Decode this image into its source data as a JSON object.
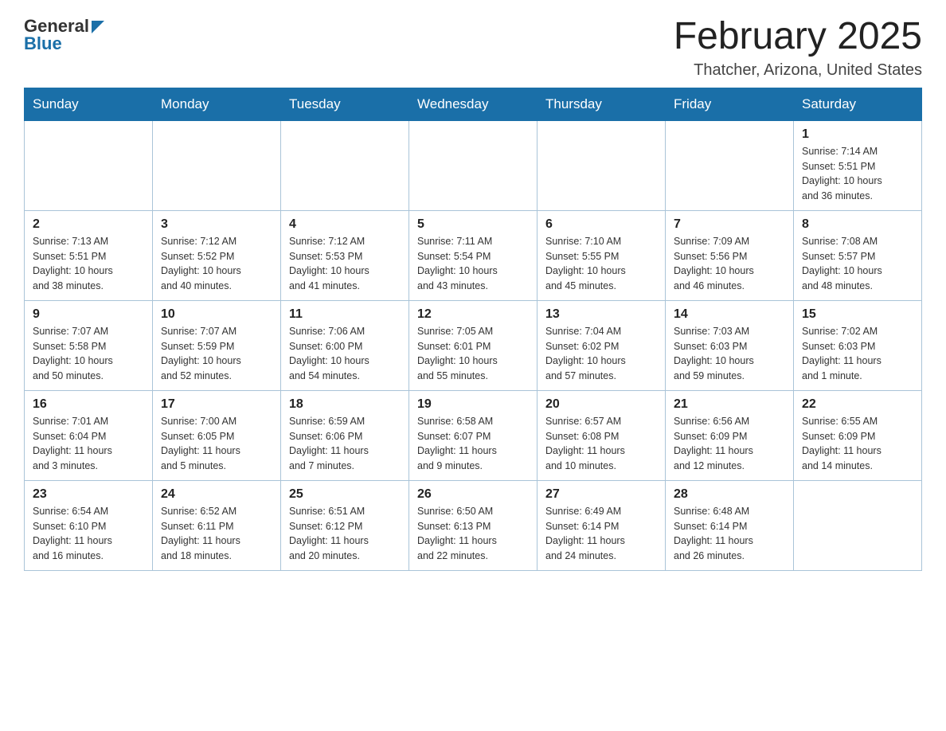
{
  "header": {
    "logo_general": "General",
    "logo_blue": "Blue",
    "month_title": "February 2025",
    "location": "Thatcher, Arizona, United States"
  },
  "weekdays": [
    "Sunday",
    "Monday",
    "Tuesday",
    "Wednesday",
    "Thursday",
    "Friday",
    "Saturday"
  ],
  "weeks": [
    [
      {
        "day": "",
        "info": ""
      },
      {
        "day": "",
        "info": ""
      },
      {
        "day": "",
        "info": ""
      },
      {
        "day": "",
        "info": ""
      },
      {
        "day": "",
        "info": ""
      },
      {
        "day": "",
        "info": ""
      },
      {
        "day": "1",
        "info": "Sunrise: 7:14 AM\nSunset: 5:51 PM\nDaylight: 10 hours\nand 36 minutes."
      }
    ],
    [
      {
        "day": "2",
        "info": "Sunrise: 7:13 AM\nSunset: 5:51 PM\nDaylight: 10 hours\nand 38 minutes."
      },
      {
        "day": "3",
        "info": "Sunrise: 7:12 AM\nSunset: 5:52 PM\nDaylight: 10 hours\nand 40 minutes."
      },
      {
        "day": "4",
        "info": "Sunrise: 7:12 AM\nSunset: 5:53 PM\nDaylight: 10 hours\nand 41 minutes."
      },
      {
        "day": "5",
        "info": "Sunrise: 7:11 AM\nSunset: 5:54 PM\nDaylight: 10 hours\nand 43 minutes."
      },
      {
        "day": "6",
        "info": "Sunrise: 7:10 AM\nSunset: 5:55 PM\nDaylight: 10 hours\nand 45 minutes."
      },
      {
        "day": "7",
        "info": "Sunrise: 7:09 AM\nSunset: 5:56 PM\nDaylight: 10 hours\nand 46 minutes."
      },
      {
        "day": "8",
        "info": "Sunrise: 7:08 AM\nSunset: 5:57 PM\nDaylight: 10 hours\nand 48 minutes."
      }
    ],
    [
      {
        "day": "9",
        "info": "Sunrise: 7:07 AM\nSunset: 5:58 PM\nDaylight: 10 hours\nand 50 minutes."
      },
      {
        "day": "10",
        "info": "Sunrise: 7:07 AM\nSunset: 5:59 PM\nDaylight: 10 hours\nand 52 minutes."
      },
      {
        "day": "11",
        "info": "Sunrise: 7:06 AM\nSunset: 6:00 PM\nDaylight: 10 hours\nand 54 minutes."
      },
      {
        "day": "12",
        "info": "Sunrise: 7:05 AM\nSunset: 6:01 PM\nDaylight: 10 hours\nand 55 minutes."
      },
      {
        "day": "13",
        "info": "Sunrise: 7:04 AM\nSunset: 6:02 PM\nDaylight: 10 hours\nand 57 minutes."
      },
      {
        "day": "14",
        "info": "Sunrise: 7:03 AM\nSunset: 6:03 PM\nDaylight: 10 hours\nand 59 minutes."
      },
      {
        "day": "15",
        "info": "Sunrise: 7:02 AM\nSunset: 6:03 PM\nDaylight: 11 hours\nand 1 minute."
      }
    ],
    [
      {
        "day": "16",
        "info": "Sunrise: 7:01 AM\nSunset: 6:04 PM\nDaylight: 11 hours\nand 3 minutes."
      },
      {
        "day": "17",
        "info": "Sunrise: 7:00 AM\nSunset: 6:05 PM\nDaylight: 11 hours\nand 5 minutes."
      },
      {
        "day": "18",
        "info": "Sunrise: 6:59 AM\nSunset: 6:06 PM\nDaylight: 11 hours\nand 7 minutes."
      },
      {
        "day": "19",
        "info": "Sunrise: 6:58 AM\nSunset: 6:07 PM\nDaylight: 11 hours\nand 9 minutes."
      },
      {
        "day": "20",
        "info": "Sunrise: 6:57 AM\nSunset: 6:08 PM\nDaylight: 11 hours\nand 10 minutes."
      },
      {
        "day": "21",
        "info": "Sunrise: 6:56 AM\nSunset: 6:09 PM\nDaylight: 11 hours\nand 12 minutes."
      },
      {
        "day": "22",
        "info": "Sunrise: 6:55 AM\nSunset: 6:09 PM\nDaylight: 11 hours\nand 14 minutes."
      }
    ],
    [
      {
        "day": "23",
        "info": "Sunrise: 6:54 AM\nSunset: 6:10 PM\nDaylight: 11 hours\nand 16 minutes."
      },
      {
        "day": "24",
        "info": "Sunrise: 6:52 AM\nSunset: 6:11 PM\nDaylight: 11 hours\nand 18 minutes."
      },
      {
        "day": "25",
        "info": "Sunrise: 6:51 AM\nSunset: 6:12 PM\nDaylight: 11 hours\nand 20 minutes."
      },
      {
        "day": "26",
        "info": "Sunrise: 6:50 AM\nSunset: 6:13 PM\nDaylight: 11 hours\nand 22 minutes."
      },
      {
        "day": "27",
        "info": "Sunrise: 6:49 AM\nSunset: 6:14 PM\nDaylight: 11 hours\nand 24 minutes."
      },
      {
        "day": "28",
        "info": "Sunrise: 6:48 AM\nSunset: 6:14 PM\nDaylight: 11 hours\nand 26 minutes."
      },
      {
        "day": "",
        "info": ""
      }
    ]
  ]
}
